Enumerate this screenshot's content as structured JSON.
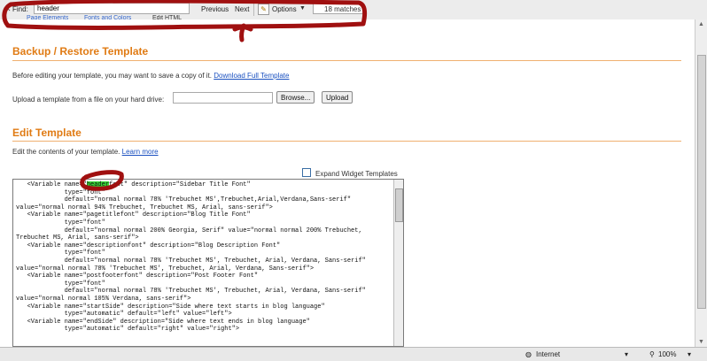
{
  "find_bar": {
    "close_glyph": "✕",
    "label": "Find:",
    "query": "header",
    "previous_label": "Previous",
    "next_label": "Next",
    "options_label": "Options",
    "options_caret": "▼",
    "matches_text": "18 matches"
  },
  "partial_tabs": [
    "Page Elements",
    "Fonts and Colors",
    "Edit HTML"
  ],
  "backup_section": {
    "title": "Backup / Restore Template",
    "intro_text": "Before editing your template, you may want to save a copy of it.",
    "download_link": "Download Full Template",
    "upload_label": "Upload a template from a file on your hard drive:",
    "browse_label": "Browse...",
    "upload_button": "Upload"
  },
  "edit_section": {
    "title": "Edit Template",
    "intro_text": "Edit the contents of your template.",
    "learn_more_link": "Learn more",
    "expand_widgets_label": "Expand Widget Templates",
    "highlight_text": "header",
    "code_before_highlight": "   <Variable name=\"",
    "code_after_highlight": "font\" description=\"Sidebar Title Font\"",
    "code_lines": [
      "             type=\"font\"",
      "             default=\"normal normal 78% 'Trebuchet MS',Trebuchet,Arial,Verdana,Sans-serif\"",
      "value=\"normal normal 94% Trebuchet, Trebuchet MS, Arial, sans-serif\">",
      "   <Variable name=\"pagetitlefont\" description=\"Blog Title Font\"",
      "             type=\"font\"",
      "             default=\"normal normal 200% Georgia, Serif\" value=\"normal normal 200% Trebuchet,",
      "Trebuchet MS, Arial, sans-serif\">",
      "   <Variable name=\"descriptionfont\" description=\"Blog Description Font\"",
      "             type=\"font\"",
      "             default=\"normal normal 78% 'Trebuchet MS', Trebuchet, Arial, Verdana, Sans-serif\"",
      "value=\"normal normal 78% 'Trebuchet MS', Trebuchet, Arial, Verdana, Sans-serif\">",
      "   <Variable name=\"postfooterfont\" description=\"Post Footer Font\"",
      "             type=\"font\"",
      "             default=\"normal normal 78% 'Trebuchet MS', Trebuchet, Arial, Verdana, Sans-serif\"",
      "value=\"normal normal 105% Verdana, sans-serif\">",
      "   <Variable name=\"startSide\" description=\"Side where text starts in blog language\"",
      "             type=\"automatic\" default=\"left\" value=\"left\">",
      "   <Variable name=\"endSide\" description=\"Side where text ends in blog language\"",
      "             type=\"automatic\" default=\"right\" value=\"right\">"
    ]
  },
  "status_bar": {
    "zone": "Internet",
    "zoom": "100%"
  },
  "colors": {
    "heading": "#e07b14",
    "link": "#1a50c0",
    "annotation": "#a01010",
    "highlight": "#38d838"
  }
}
